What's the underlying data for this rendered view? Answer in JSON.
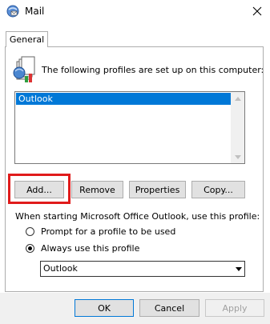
{
  "window": {
    "title": "Mail",
    "icon": "mail-icon",
    "close_icon": "close-icon"
  },
  "tabs": [
    {
      "label": "General"
    }
  ],
  "description": "The following profiles are set up on this computer:",
  "profiles_icon": "profiles-icon",
  "profiles_list": {
    "items": [
      "Outlook"
    ],
    "selected_index": 0
  },
  "profile_buttons": {
    "add": "Add...",
    "remove": "Remove",
    "properties": "Properties",
    "copy": "Copy..."
  },
  "startup": {
    "label": "When starting Microsoft Office Outlook, use this profile:",
    "options": [
      {
        "label": "Prompt for a profile to be used",
        "checked": false
      },
      {
        "label": "Always use this profile",
        "checked": true
      }
    ],
    "selected_profile": "Outlook"
  },
  "dialog_buttons": {
    "ok": "OK",
    "cancel": "Cancel",
    "apply": "Apply"
  },
  "colors": {
    "selection": "#0078d7",
    "highlight_box": "#e01b1b"
  }
}
